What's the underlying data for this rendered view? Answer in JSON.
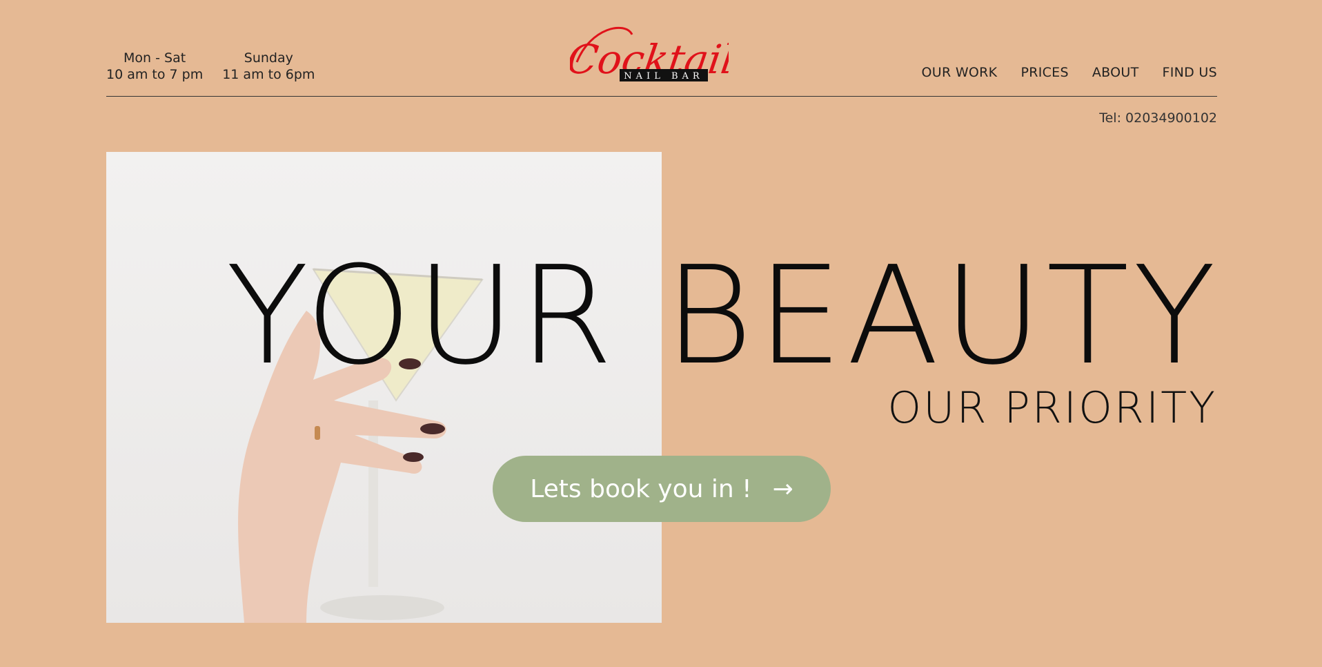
{
  "hours": [
    {
      "days": "Mon - Sat",
      "time": "10 am to 7 pm"
    },
    {
      "days": "Sunday",
      "time": "11 am to 6pm"
    }
  ],
  "brand": {
    "name": "Cocktail",
    "tagline": "NAIL BAR",
    "color": "#e0121a"
  },
  "nav": {
    "items": [
      "OUR WORK",
      "PRICES",
      "ABOUT",
      "FIND US"
    ]
  },
  "contact": {
    "phone": "Tel: 02034900102"
  },
  "hero": {
    "headline": "YOUR BEAUTY",
    "subhead": "OUR PRIORITY",
    "cta_label": "Lets book you in !",
    "cta_icon": "arrow-right-icon",
    "accent_color": "#a0b28a"
  }
}
